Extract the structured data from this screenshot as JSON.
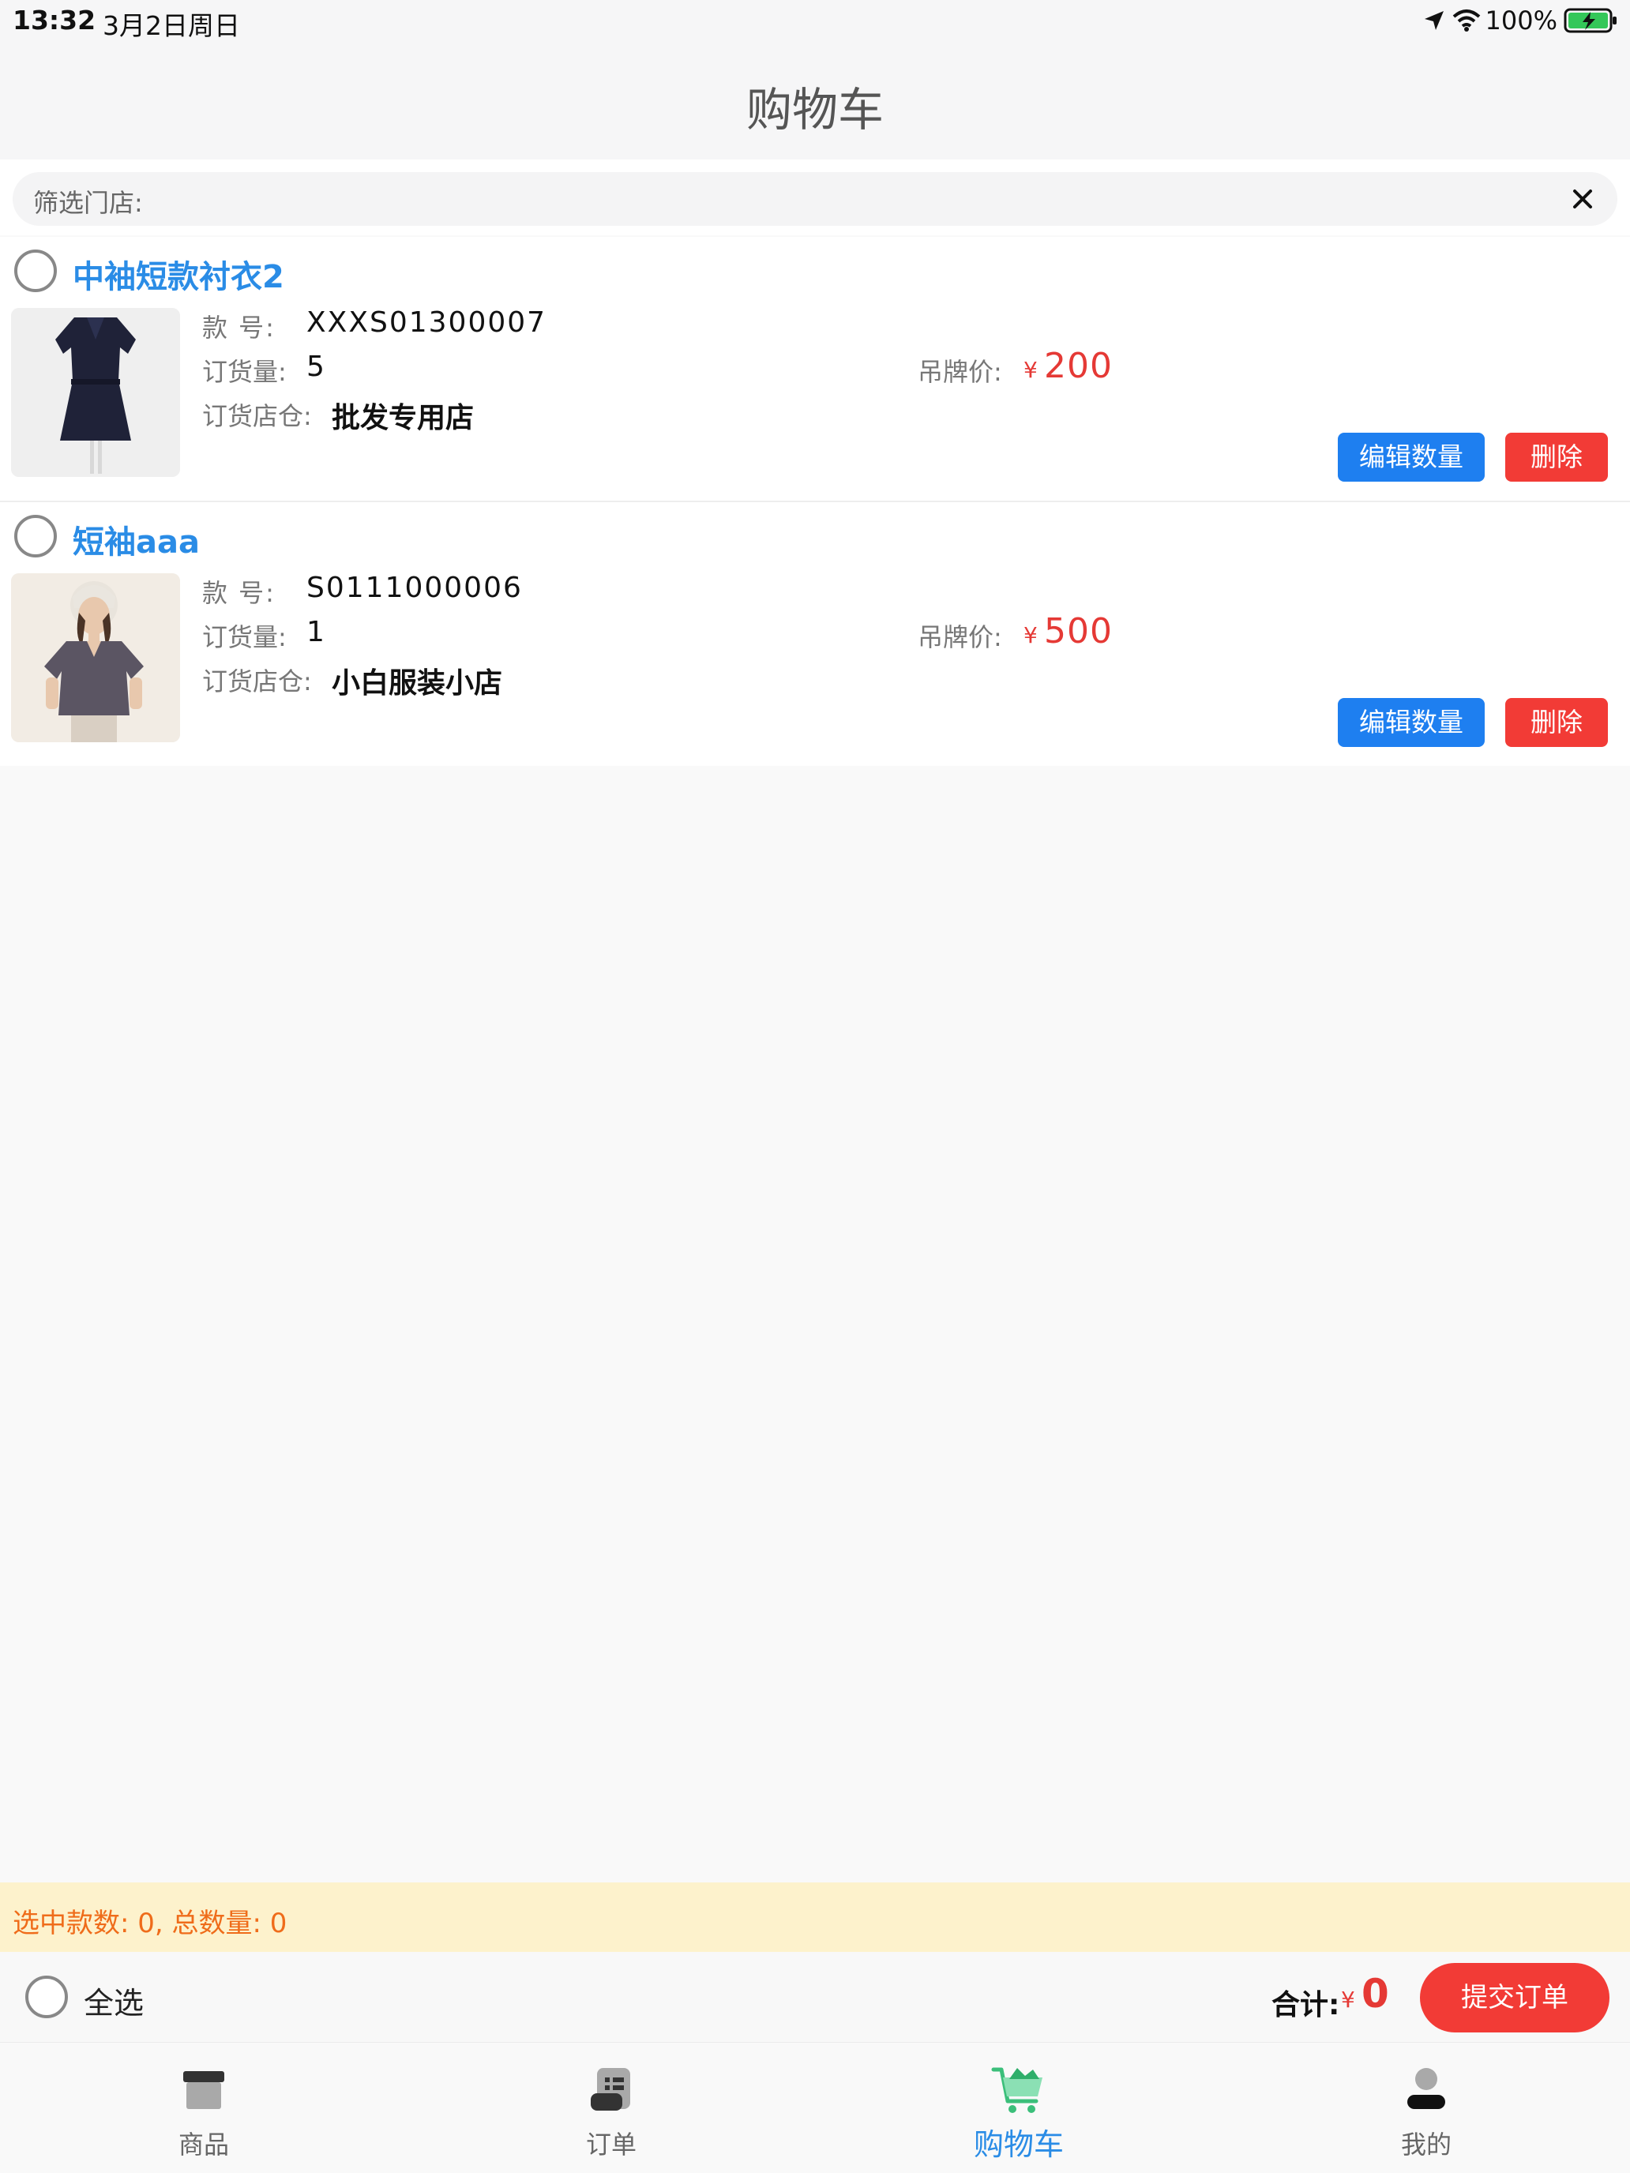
{
  "status_bar": {
    "time": "13:32",
    "date": "3月2日周日",
    "battery": "100%",
    "icons": [
      "location-arrow-icon",
      "wifi-icon",
      "battery-charging-icon"
    ]
  },
  "nav": {
    "title": "购物车"
  },
  "filter": {
    "label": "筛选门店:",
    "clear_icon": "close-icon"
  },
  "items": [
    {
      "name": "中袖短款衬衣2",
      "style_label": "款 号:",
      "style_no": "XXXS01300007",
      "qty_label": "订货量:",
      "qty": "5",
      "store_label": "订货店仓:",
      "store": "批发专用店",
      "price_label": "吊牌价:",
      "currency": "¥",
      "price": "200",
      "edit_label": "编辑数量",
      "delete_label": "删除"
    },
    {
      "name": "短袖aaa",
      "style_label": "款 号:",
      "style_no": "S0111000006",
      "qty_label": "订货量:",
      "qty": "1",
      "store_label": "订货店仓:",
      "store": "小白服装小店",
      "price_label": "吊牌价:",
      "currency": "¥",
      "price": "500",
      "edit_label": "编辑数量",
      "delete_label": "删除"
    }
  ],
  "summary": {
    "text": "选中款数: 0, 总数量: 0"
  },
  "action_bar": {
    "select_all": "全选",
    "total_label": "合计:",
    "currency": "¥",
    "total": "0",
    "submit": "提交订单"
  },
  "tabs": [
    {
      "label": "商品",
      "icon": "goods-box-icon",
      "active": false
    },
    {
      "label": "订单",
      "icon": "order-list-icon",
      "active": false
    },
    {
      "label": "购物车",
      "icon": "shopping-cart-icon",
      "active": true
    },
    {
      "label": "我的",
      "icon": "user-icon",
      "active": false
    }
  ],
  "colors": {
    "accent_blue": "#2a8ce6",
    "button_blue": "#1e7ff0",
    "danger_red": "#f23b36",
    "price_red": "#e53935",
    "summary_bg": "#fdf2cc",
    "summary_text": "#ef6c1a",
    "cart_green": "#4fd18b"
  }
}
